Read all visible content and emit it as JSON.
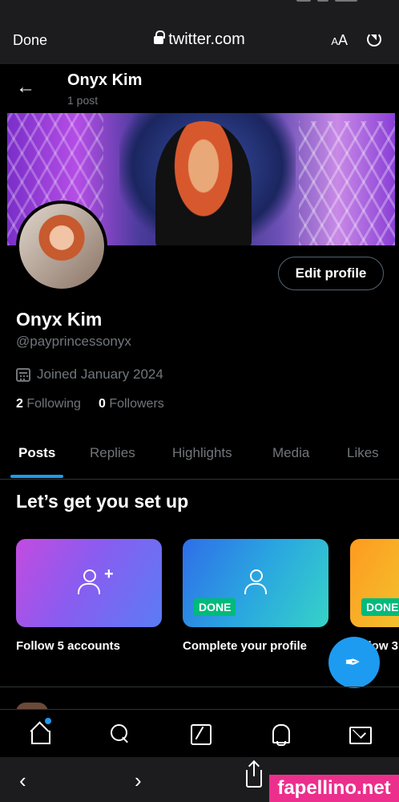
{
  "browser": {
    "done_label": "Done",
    "url": "twitter.com",
    "text_size_label_small": "A",
    "text_size_label_large": "A",
    "reload_icon": "reload-icon",
    "back_icon": "chevron-left-icon",
    "forward_icon": "chevron-right-icon",
    "share_icon": "share-icon"
  },
  "header": {
    "name": "Onyx Kim",
    "post_count": "1 post"
  },
  "profile": {
    "name": "Onyx Kim",
    "handle": "@payprincessonyx",
    "joined": "Joined January 2024",
    "following_count": "2",
    "following_label": "Following",
    "followers_count": "0",
    "followers_label": "Followers",
    "edit_label": "Edit profile"
  },
  "tabs": [
    {
      "label": "Posts",
      "active": true
    },
    {
      "label": "Replies"
    },
    {
      "label": "Highlights"
    },
    {
      "label": "Media"
    },
    {
      "label": "Likes"
    }
  ],
  "setup": {
    "title": "Let’s get you set up",
    "cards": [
      {
        "label": "Follow 5 accounts",
        "badge": ""
      },
      {
        "label": "Complete your profile",
        "badge": "DONE"
      },
      {
        "label": "Follow 3",
        "badge": "DONE"
      }
    ]
  },
  "bottom_nav": [
    "home-icon",
    "search-icon",
    "grok-icon",
    "bell-icon",
    "mail-icon"
  ],
  "watermark": "fapellino.net",
  "colors": {
    "accent": "#1d9bf0",
    "done_badge": "#00ba7c",
    "watermark": "#ec2f8c"
  }
}
